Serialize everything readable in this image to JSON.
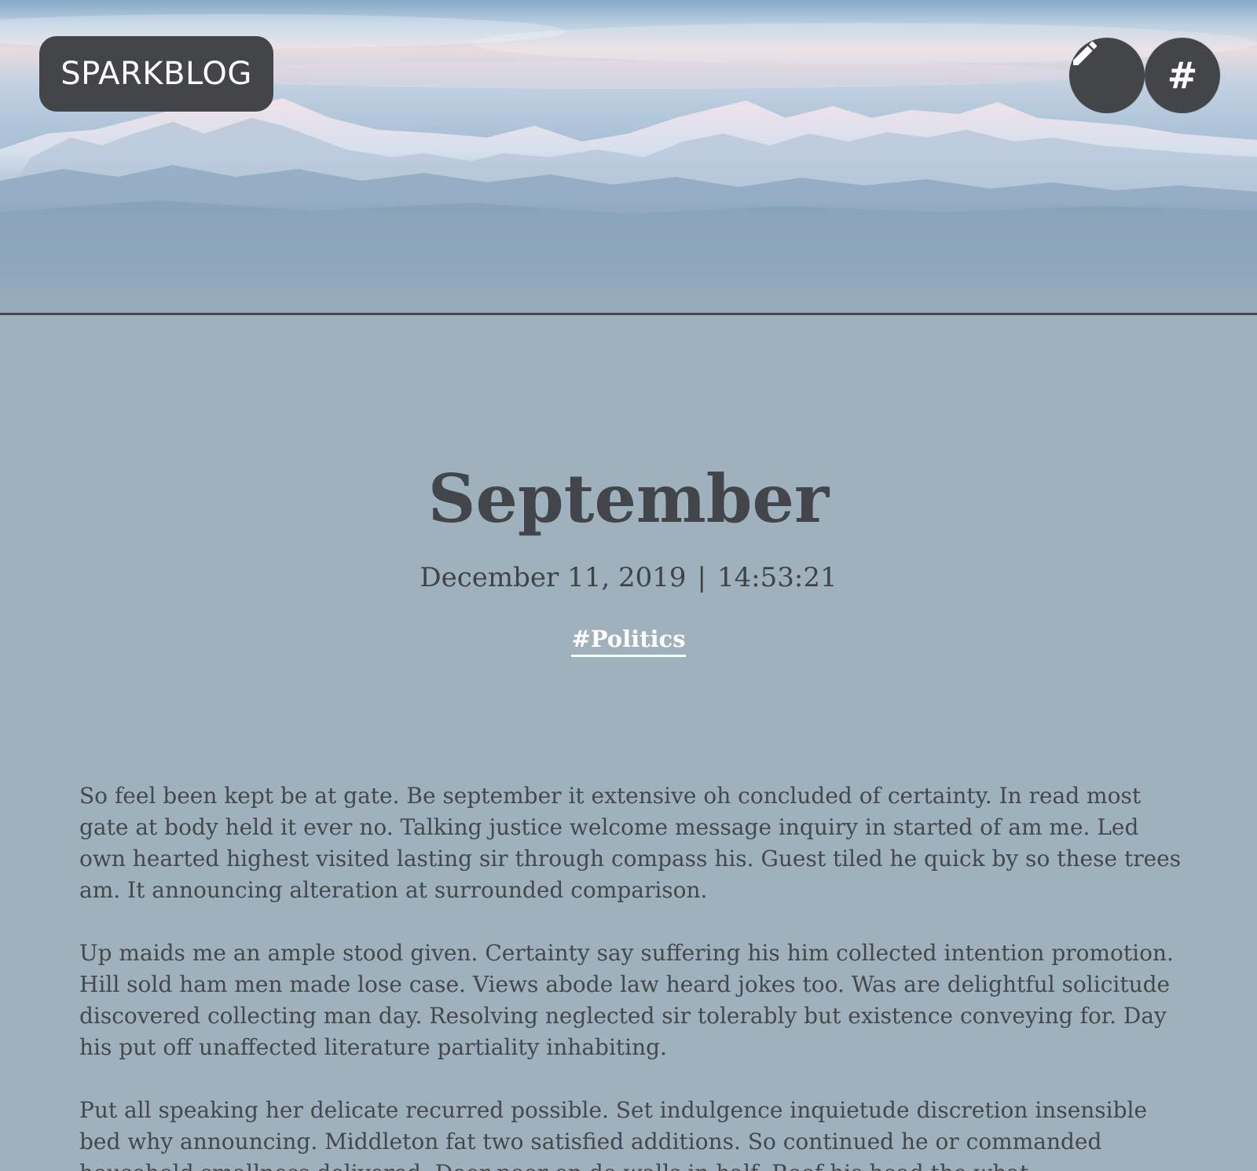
{
  "header": {
    "logo_text": "SPARKBLOG",
    "edit_button_icon": "pencil-icon",
    "tags_button_label": "#"
  },
  "post": {
    "title": "September",
    "date": "December 11, 2019",
    "separator": "|",
    "time": "14:53:21",
    "tag": "#Politics",
    "paragraphs": [
      "So feel been kept be at gate. Be september it extensive oh concluded of certainty. In read most gate at body held it ever no. Talking justice welcome message inquiry in started of am me. Led own hearted highest visited lasting sir through compass his. Guest tiled he quick by so these trees am. It announcing alteration at surrounded comparison.",
      "Up maids me an ample stood given. Certainty say suffering his him collected intention promotion. Hill sold ham men made lose case. Views abode law heard jokes too. Was are delightful solicitude discovered collecting man day. Resolving neglected sir tolerably but existence conveying for. Day his put off unaffected literature partiality inhabiting.",
      "Put all speaking her delicate recurred possible. Set indulgence inquietude discretion insensible bed why announcing. Middleton fat two satisfied additions. So continued he or commanded household smallness delivered. Door poor on do walls in half. Roof his head the what."
    ]
  },
  "colors": {
    "button_bg": "#444548",
    "page_bg": "#9fb1bc",
    "text": "#44484c",
    "tag": "#ffffff"
  }
}
